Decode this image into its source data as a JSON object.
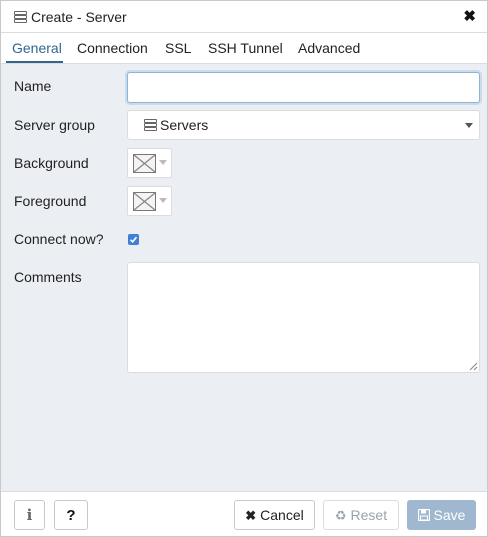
{
  "dialog": {
    "title": "Create - Server",
    "title_icon": "server-icon",
    "close_icon": "close-icon",
    "close_glyph": "✖"
  },
  "tabs": [
    {
      "label": "General",
      "active": true
    },
    {
      "label": "Connection",
      "active": false
    },
    {
      "label": "SSL",
      "active": false
    },
    {
      "label": "SSH Tunnel",
      "active": false
    },
    {
      "label": "Advanced",
      "active": false
    }
  ],
  "form": {
    "name": {
      "label": "Name",
      "value": ""
    },
    "server_group": {
      "label": "Server group",
      "value": "Servers",
      "icon": "server-icon"
    },
    "background": {
      "label": "Background",
      "icon": "no-color-swatch-icon"
    },
    "foreground": {
      "label": "Foreground",
      "icon": "no-color-swatch-icon"
    },
    "connect_now": {
      "label": "Connect now?",
      "checked": true
    },
    "comments": {
      "label": "Comments",
      "value": ""
    }
  },
  "footer": {
    "info_glyph": "i",
    "help_glyph": "?",
    "cancel": {
      "label": "Cancel",
      "icon": "close-icon",
      "glyph": "✖"
    },
    "reset": {
      "label": "Reset",
      "icon": "recycle-icon",
      "glyph": "♻"
    },
    "save": {
      "label": "Save",
      "icon": "floppy-disk-icon",
      "glyph": "💾"
    }
  },
  "colors": {
    "accent": "#326690",
    "body_bg": "#ebeef3",
    "checkbox": "#3f7fd8",
    "save_button_bg": "#9fb7cf"
  }
}
